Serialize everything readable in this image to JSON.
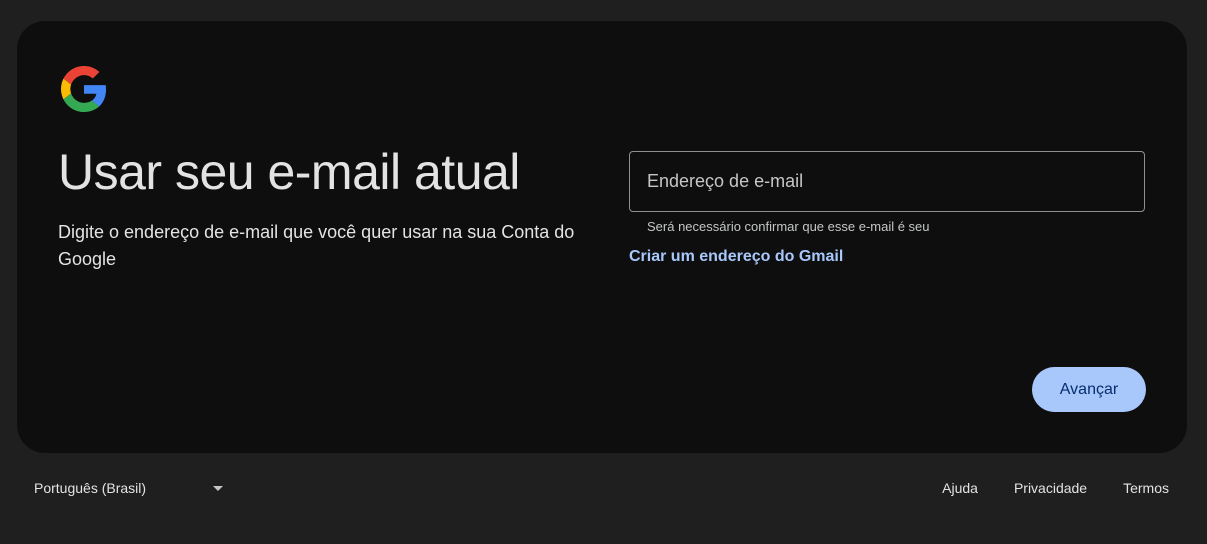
{
  "logo": {
    "icon": "google-g-icon"
  },
  "heading": {
    "title": "Usar seu e-mail atual",
    "subtitle": "Digite o endereço de e-mail que você quer usar na sua Conta do Google"
  },
  "form": {
    "email_value": "",
    "email_placeholder": "Endereço de e-mail",
    "hint": "Será necessário confirmar que esse e-mail é seu",
    "gmail_link": "Criar um endereço do Gmail",
    "next_label": "Avançar"
  },
  "footer": {
    "language": "Português (Brasil)",
    "links": {
      "help": "Ajuda",
      "privacy": "Privacidade",
      "terms": "Termos"
    }
  },
  "colors": {
    "page_background": "#1f1f1f",
    "card_background": "#0e0e0e",
    "accent": "#a8c7fa",
    "google_blue": "#4285F4",
    "google_red": "#EA4335",
    "google_yellow": "#FBBC05",
    "google_green": "#34A853"
  }
}
